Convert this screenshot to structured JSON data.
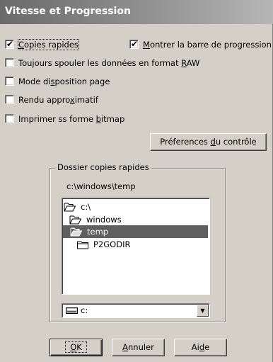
{
  "window": {
    "title": "Vitesse et Progression"
  },
  "options": {
    "copies_rapides": {
      "label_pre": "",
      "label_u": "C",
      "label_post": "opies rapides",
      "checked": true
    },
    "barre_progression": {
      "label_pre": "",
      "label_u": "M",
      "label_post": "ontrer la barre de progression",
      "checked": true
    },
    "spouler_raw": {
      "label_pre": "Toujours spouler les données en format ",
      "label_u": "R",
      "label_post": "AW",
      "checked": false
    },
    "disposition_page": {
      "label_pre": "Mode di",
      "label_u": "s",
      "label_post": "position page",
      "checked": false
    },
    "rendu_approx": {
      "label_pre": "Rendu appro",
      "label_u": "x",
      "label_post": "imatif",
      "checked": false
    },
    "forme_bitmap": {
      "label_pre": "Imprimer ss forme ",
      "label_u": "b",
      "label_post": "itmap",
      "checked": false
    }
  },
  "preferences_button": {
    "label_pre": "Préferences ",
    "label_u": "d",
    "label_post": "u contrôle"
  },
  "folder_group": {
    "title": "Dossier copies rapides",
    "path": "c:\\windows\\temp",
    "tree": [
      {
        "label": "c:\\",
        "icon": "open-folder-icon",
        "selected": false
      },
      {
        "label": "windows",
        "icon": "open-folder-icon",
        "selected": false
      },
      {
        "label": "temp",
        "icon": "open-folder-icon",
        "selected": true
      },
      {
        "label": "P2GODIR",
        "icon": "closed-folder-icon",
        "selected": false
      }
    ],
    "drive": {
      "value": "c:",
      "icon": "drive-icon"
    }
  },
  "buttons": {
    "ok": {
      "label_pre": "",
      "label_u": "O",
      "label_post": "K"
    },
    "annuler": {
      "label_pre": "",
      "label_u": "A",
      "label_post": "nnuler"
    },
    "aide": {
      "label_pre": "Ai",
      "label_u": "d",
      "label_post": "e"
    }
  },
  "colors": {
    "dialog_bg": "#d4d0c8",
    "selection": "#5f5f5f",
    "title_text": "#ffffff"
  }
}
